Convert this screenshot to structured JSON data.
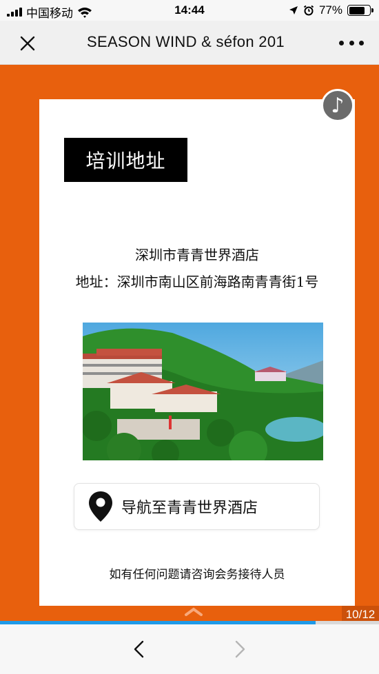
{
  "status_bar": {
    "carrier": "中国移动",
    "time": "14:44",
    "battery": "77%",
    "battery_level": 0.77
  },
  "nav_bar": {
    "title": "SEASON WIND & séfon 201",
    "close_icon": "close-icon",
    "more_icon": "more-dots-icon"
  },
  "content": {
    "section_title": "培训地址",
    "hotel_name": "深圳市青青世界酒店",
    "address": "地址：深圳市南山区前海路南青青街1号",
    "photo_icon": "hotel-photo",
    "nav_button_label": "导航至青青世界酒店",
    "contact_note": "如有任何问题请咨询会务接待人员",
    "music_icon": "♪"
  },
  "pager": {
    "counter": "10/12",
    "progress": 0.833
  },
  "colors": {
    "accent_orange": "#e8600d",
    "progress_blue": "#1f9ae8"
  }
}
